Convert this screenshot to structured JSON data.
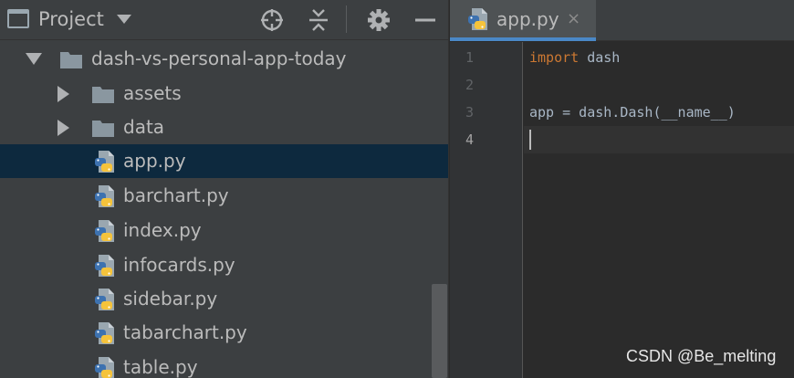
{
  "project_panel": {
    "title": "Project",
    "toolbar_icons": [
      "locate-icon",
      "collapse-all-icon",
      "gear-icon",
      "hide-icon"
    ],
    "tree": {
      "root": {
        "label": "dash-vs-personal-app-today",
        "expanded": true
      },
      "folders": [
        {
          "label": "assets",
          "expanded": false
        },
        {
          "label": "data",
          "expanded": false
        }
      ],
      "files": [
        {
          "label": "app.py",
          "selected": true
        },
        {
          "label": "barchart.py"
        },
        {
          "label": "index.py"
        },
        {
          "label": "infocards.py"
        },
        {
          "label": "sidebar.py"
        },
        {
          "label": "tabarchart.py"
        },
        {
          "label": "table.py"
        }
      ]
    }
  },
  "editor": {
    "tab": {
      "label": "app.py",
      "close": "×"
    },
    "line_numbers": [
      "1",
      "2",
      "3",
      "4"
    ],
    "current_line": "4",
    "code": {
      "line1_keyword": "import",
      "line1_rest": " dash",
      "line2": "",
      "line3": "app = dash.Dash(__name__)",
      "line4": ""
    }
  },
  "watermark": "CSDN @Be_melting",
  "colors": {
    "panel_bg": "#3c3f41",
    "editor_bg": "#2b2b2b",
    "selection_bg": "#0d293e",
    "tab_accent": "#4a88c7",
    "keyword": "#cc7832",
    "code_text": "#a9b7c6",
    "folder": "#8a97a0",
    "python_blue": "#3d72b0",
    "python_yellow": "#f5c33b"
  }
}
